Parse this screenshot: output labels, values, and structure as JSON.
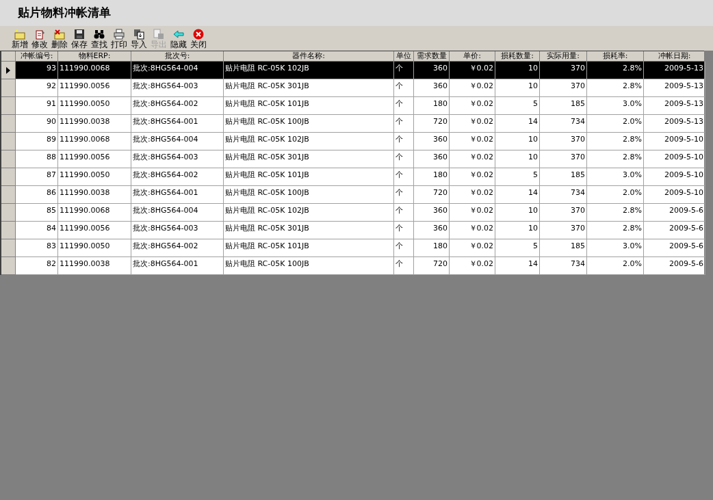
{
  "window": {
    "title": "贴片物料冲帐清单"
  },
  "toolbar": [
    {
      "kind": "new",
      "label": "新增",
      "disabled": false
    },
    {
      "kind": "edit",
      "label": "修改",
      "disabled": false
    },
    {
      "kind": "delete",
      "label": "删除",
      "disabled": false
    },
    {
      "kind": "save",
      "label": "保存",
      "disabled": false
    },
    {
      "kind": "find",
      "label": "查找",
      "disabled": false
    },
    {
      "kind": "print",
      "label": "打印",
      "disabled": false
    },
    {
      "kind": "import",
      "label": "导入",
      "disabled": false
    },
    {
      "kind": "export",
      "label": "导出",
      "disabled": true
    },
    {
      "kind": "hide",
      "label": "隐藏",
      "disabled": false
    },
    {
      "kind": "close",
      "label": "关闭",
      "disabled": false
    }
  ],
  "table": {
    "columns": [
      "冲帐编号:",
      "物料ERP:",
      "批次号:",
      "器件名称:",
      "单位",
      "需求数量",
      "单价:",
      "损耗数量:",
      "实际用量:",
      "损耗率:",
      "冲帐日期:"
    ],
    "rows": [
      {
        "selected": true,
        "cells": [
          "93",
          "111990.0068",
          "批次:8HG564-004",
          "贴片电阻 RC-05K 102JB",
          "个",
          "360",
          "￥0.02",
          "10",
          "370",
          "2.8%",
          "2009-5-13"
        ]
      },
      {
        "selected": false,
        "cells": [
          "92",
          "111990.0056",
          "批次:8HG564-003",
          "贴片电阻 RC-05K 301JB",
          "个",
          "360",
          "￥0.02",
          "10",
          "370",
          "2.8%",
          "2009-5-13"
        ]
      },
      {
        "selected": false,
        "cells": [
          "91",
          "111990.0050",
          "批次:8HG564-002",
          "贴片电阻 RC-05K 101JB",
          "个",
          "180",
          "￥0.02",
          "5",
          "185",
          "3.0%",
          "2009-5-13"
        ]
      },
      {
        "selected": false,
        "cells": [
          "90",
          "111990.0038",
          "批次:8HG564-001",
          "贴片电阻 RC-05K 100JB",
          "个",
          "720",
          "￥0.02",
          "14",
          "734",
          "2.0%",
          "2009-5-13"
        ]
      },
      {
        "selected": false,
        "cells": [
          "89",
          "111990.0068",
          "批次:8HG564-004",
          "贴片电阻 RC-05K 102JB",
          "个",
          "360",
          "￥0.02",
          "10",
          "370",
          "2.8%",
          "2009-5-10"
        ]
      },
      {
        "selected": false,
        "cells": [
          "88",
          "111990.0056",
          "批次:8HG564-003",
          "贴片电阻 RC-05K 301JB",
          "个",
          "360",
          "￥0.02",
          "10",
          "370",
          "2.8%",
          "2009-5-10"
        ]
      },
      {
        "selected": false,
        "cells": [
          "87",
          "111990.0050",
          "批次:8HG564-002",
          "贴片电阻 RC-05K 101JB",
          "个",
          "180",
          "￥0.02",
          "5",
          "185",
          "3.0%",
          "2009-5-10"
        ]
      },
      {
        "selected": false,
        "cells": [
          "86",
          "111990.0038",
          "批次:8HG564-001",
          "贴片电阻 RC-05K 100JB",
          "个",
          "720",
          "￥0.02",
          "14",
          "734",
          "2.0%",
          "2009-5-10"
        ]
      },
      {
        "selected": false,
        "cells": [
          "85",
          "111990.0068",
          "批次:8HG564-004",
          "贴片电阻 RC-05K 102JB",
          "个",
          "360",
          "￥0.02",
          "10",
          "370",
          "2.8%",
          "2009-5-6"
        ]
      },
      {
        "selected": false,
        "cells": [
          "84",
          "111990.0056",
          "批次:8HG564-003",
          "贴片电阻 RC-05K 301JB",
          "个",
          "360",
          "￥0.02",
          "10",
          "370",
          "2.8%",
          "2009-5-6"
        ]
      },
      {
        "selected": false,
        "cells": [
          "83",
          "111990.0050",
          "批次:8HG564-002",
          "贴片电阻 RC-05K 101JB",
          "个",
          "180",
          "￥0.02",
          "5",
          "185",
          "3.0%",
          "2009-5-6"
        ]
      },
      {
        "selected": false,
        "cells": [
          "82",
          "111990.0038",
          "批次:8HG564-001",
          "贴片电阻 RC-05K 100JB",
          "个",
          "720",
          "￥0.02",
          "14",
          "734",
          "2.0%",
          "2009-5-6"
        ]
      }
    ]
  }
}
